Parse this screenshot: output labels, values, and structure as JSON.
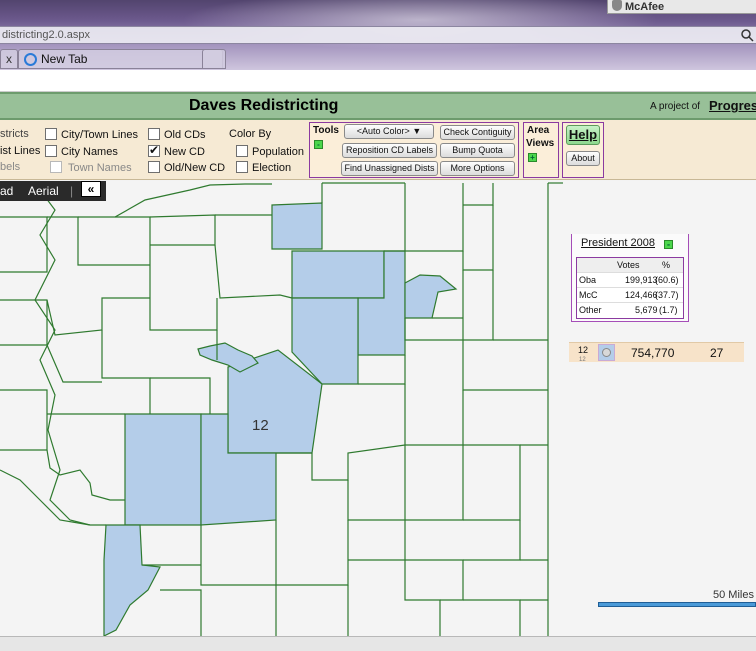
{
  "browser": {
    "address": "districting2.0.aspx",
    "tab_close": "x",
    "tab_label": "New Tab",
    "toolbar_brand": "McAfee"
  },
  "header": {
    "title": "Daves Redistricting",
    "project_of": "A project of",
    "project_link": "Progress"
  },
  "toolbar": {
    "show": [
      {
        "label": "stricts",
        "checked": false
      },
      {
        "label": "ist Lines",
        "checked": false
      },
      {
        "label": "bels",
        "checked": false
      }
    ],
    "places": [
      {
        "label": "City/Town Lines",
        "checked": false
      },
      {
        "label": "City Names",
        "checked": false
      },
      {
        "label": "Town Names",
        "checked": false
      }
    ],
    "cds": [
      {
        "label": "Old CDs",
        "checked": false
      },
      {
        "label": "New CD",
        "checked": true
      },
      {
        "label": "Old/New CD",
        "checked": false
      }
    ],
    "color_by_label": "Color By",
    "color_by": [
      {
        "label": "Population",
        "checked": false
      },
      {
        "label": "Election",
        "checked": false
      }
    ],
    "tools_label": "Tools",
    "tools_toggle": "-",
    "auto_color": "<Auto Color>",
    "reposition_labels": "Reposition CD Labels",
    "find_unassigned": "Find Unassigned Dists",
    "check_contiguity": "Check Contiguity",
    "bump_quota": "Bump Quota",
    "more_options": "More Options",
    "area_label": "Area",
    "views_label": "Views",
    "views_toggle": "+",
    "help": "Help",
    "about": "About"
  },
  "map": {
    "type_road": "ad",
    "type_aerial": "Aerial",
    "type_sep": "|",
    "collapse": "«",
    "district_label": "12",
    "scale_label": "50 Miles"
  },
  "election": {
    "title": "President 2008",
    "toggle": "-",
    "col_votes": "Votes",
    "col_pct": "%",
    "rows": [
      {
        "name": "Oba",
        "votes": "199,913",
        "pct": "(60.6)"
      },
      {
        "name": "McC",
        "votes": "124,466",
        "pct": "(37.7)"
      },
      {
        "name": "Other",
        "votes": "5,679",
        "pct": "(1.7)"
      }
    ]
  },
  "district_row": {
    "number": "12",
    "number_sub": "12",
    "population": "754,770",
    "deviation": "27"
  },
  "colors": {
    "district_fill": "#b4cde9",
    "county_border": "#2f7a2f",
    "header_green": "#98c098",
    "toolbar_bg": "#f6ead4",
    "panel_border": "#8b3aa0"
  }
}
